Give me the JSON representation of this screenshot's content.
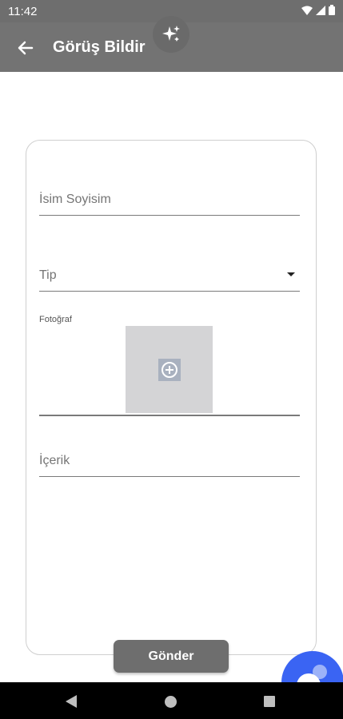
{
  "status": {
    "time": "11:42"
  },
  "app_bar": {
    "title": "Görüş Bildir",
    "back_icon": "arrow-left-icon",
    "ai_icon": "sparkle-icon"
  },
  "form": {
    "name_placeholder": "İsim Soyisim",
    "type_placeholder": "Tip",
    "photo_label": "Fotoğraf",
    "content_placeholder": "İçerik",
    "submit_label": "Gönder"
  },
  "colors": {
    "app_bar": "#737373",
    "fab": "#3a64f3"
  }
}
